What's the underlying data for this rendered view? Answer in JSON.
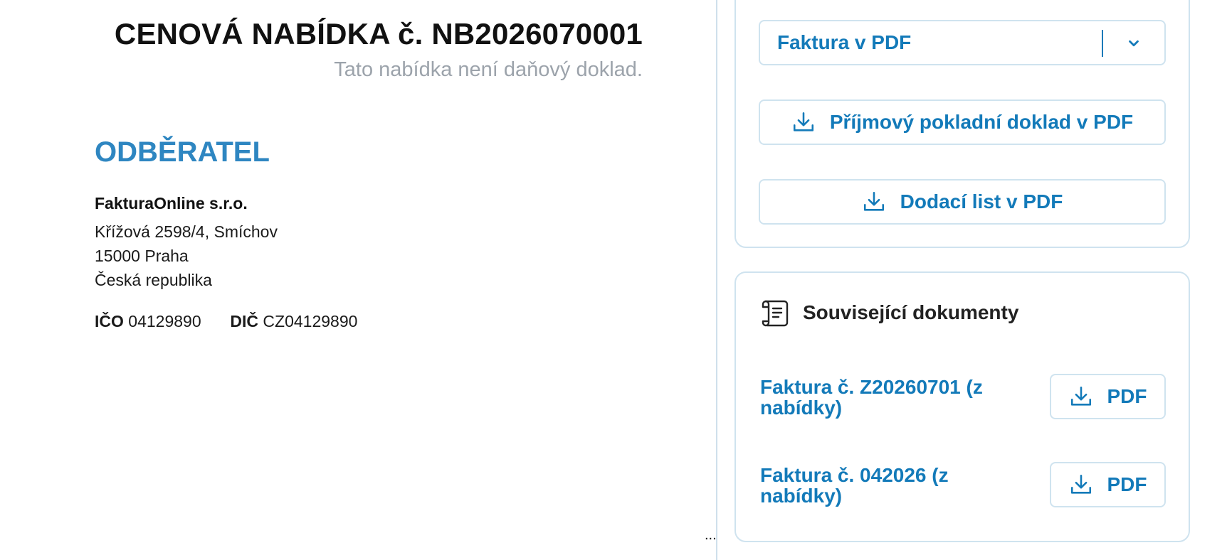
{
  "document": {
    "title": "CENOVÁ NABÍDKA č. NB2026070001",
    "subtitle": "Tato nabídka není daňový doklad.",
    "section_title": "ODBĚRATEL",
    "customer": {
      "name": "FakturaOnline s.r.o.",
      "address_line1": "Křížová 2598/4, Smíchov",
      "address_line2": "15000 Praha",
      "address_line3": "Česká republika",
      "ico_label": "IČO",
      "ico_value": "04129890",
      "dic_label": "DIČ",
      "dic_value": "CZ04129890"
    },
    "ellipsis": "..."
  },
  "actions": {
    "invoice_pdf_select": "Faktura v PDF",
    "receipt_pdf": "Příjmový pokladní doklad v PDF",
    "delivery_note_pdf": "Dodací list v PDF"
  },
  "related_documents": {
    "title": "Související dokumenty",
    "items": [
      {
        "label": "Faktura č. Z20260701 (z nabídky)",
        "button": "PDF"
      },
      {
        "label": "Faktura č. 042026 (z nabídky)",
        "button": "PDF"
      }
    ]
  },
  "colors": {
    "accent": "#137ab9",
    "section_title": "#2e86c1",
    "border": "#cfe3ef",
    "muted_text": "#9ca3ab"
  },
  "icons": {
    "select_chevron": "chevron-down-icon",
    "download": "download-icon",
    "related_docs": "scroll-document-icon"
  }
}
